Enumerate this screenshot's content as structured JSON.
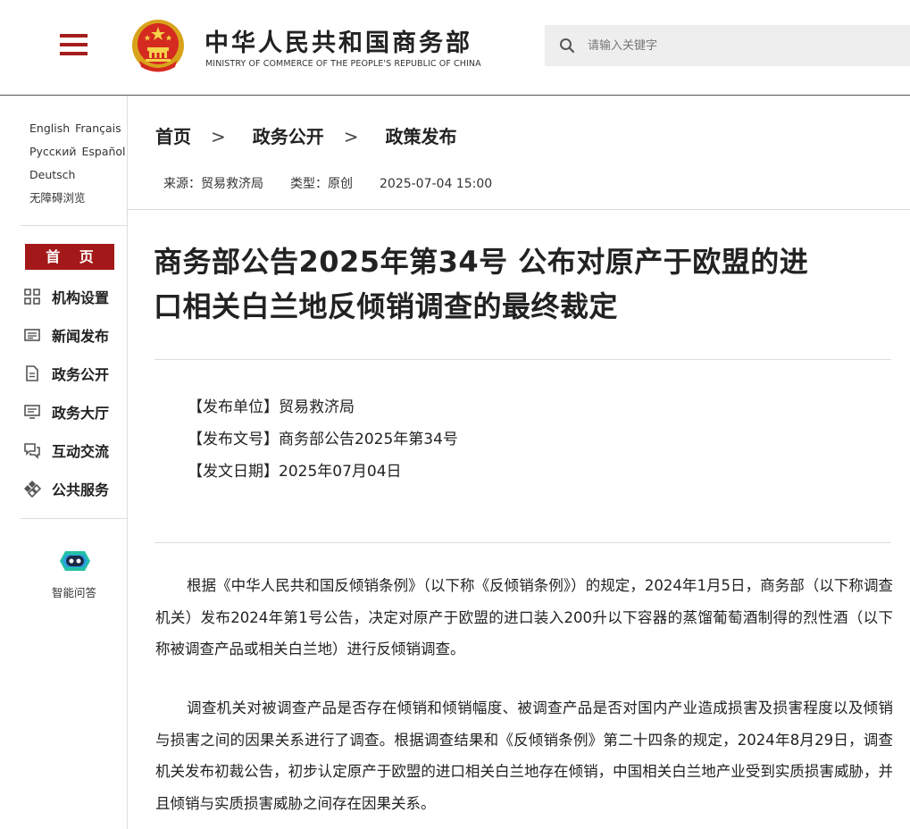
{
  "header": {
    "site_title_cn": "中华人民共和国商务部",
    "site_title_en": "MINISTRY OF COMMERCE OF THE PEOPLE'S REPUBLIC OF CHINA",
    "search_placeholder": "请输入关键字",
    "accent_color": "#a31919"
  },
  "sidebar": {
    "languages": [
      [
        "English",
        "Français"
      ],
      [
        "Русский",
        "Español"
      ],
      [
        "Deutsch"
      ],
      [
        "无障碍浏览"
      ]
    ],
    "home_label": "首 页",
    "nav_items": [
      {
        "label": "机构设置",
        "icon": "grid-icon"
      },
      {
        "label": "新闻发布",
        "icon": "newspaper-icon"
      },
      {
        "label": "政务公开",
        "icon": "document-icon"
      },
      {
        "label": "政务大厅",
        "icon": "monitor-icon"
      },
      {
        "label": "互动交流",
        "icon": "chat-icon"
      },
      {
        "label": "公共服务",
        "icon": "service-icon"
      }
    ],
    "assistant_label": "智能问答"
  },
  "breadcrumb": {
    "items": [
      "首页",
      "政务公开",
      "政策发布"
    ],
    "separator": ">"
  },
  "meta": {
    "source": "来源：贸易救济局",
    "type": "类型：原创",
    "datetime": "2025-07-04 15:00"
  },
  "article": {
    "title_line1": "商务部公告2025年第34号 公布对原产于欧盟的进",
    "title_line2": "口相关白兰地反倾销调查的最终裁定",
    "info": {
      "unit": "【发布单位】贸易救济局",
      "doc_no": "【发布文号】商务部公告2025年第34号",
      "date": "【发文日期】2025年07月04日"
    },
    "paragraphs": [
      "根据《中华人民共和国反倾销条例》（以下称《反倾销条例》）的规定，2024年1月5日，商务部（以下称调查机关）发布2024年第1号公告，决定对原产于欧盟的进口装入200升以下容器的蒸馏葡萄酒制得的烈性酒（以下称被调查产品或相关白兰地）进行反倾销调查。",
      "调查机关对被调查产品是否存在倾销和倾销幅度、被调查产品是否对国内产业造成损害及损害程度以及倾销与损害之间的因果关系进行了调查。根据调查结果和《反倾销条例》第二十四条的规定，2024年8月29日，调查机关发布初裁公告，初步认定原产于欧盟的进口相关白兰地存在倾销，中国相关白兰地产业受到实质损害威胁，并且倾销与实质损害威胁之间存在因果关系。"
    ]
  }
}
